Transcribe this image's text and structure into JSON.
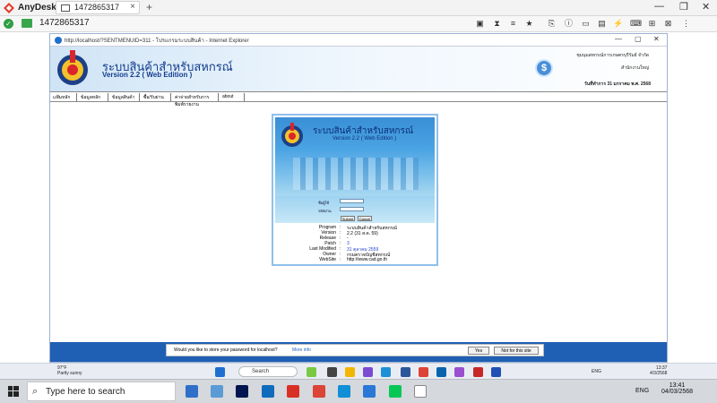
{
  "anydesk": {
    "app_name": "AnyDesk",
    "tab_label": "1472865317",
    "address": "1472865317"
  },
  "ie": {
    "title": "http://localhost/?SENTMENUID=311 - โปรแกรมระบบสินค้า - Internet Explorer"
  },
  "header": {
    "title": "ระบบสินค้าสำหรับสหกรณ์",
    "version": "Version 2.2 ( Web Edition )",
    "org": "ชุมนุมสหกรณ์การเกษตรบุรีรัมย์ จำกัด",
    "branch": "สำนักงานใหญ่",
    "date": "วันที่ทำการ 31 มกราคม พ.ศ. 2568"
  },
  "menu": {
    "items": [
      "แฟ้มหลัก",
      "ข้อมูลหลัก",
      "ข้อมูลสินค้า",
      "ซื้อ/รับผ่าน",
      "ค่าจ่ายสำหรับการพิมพ์รายงาน",
      "about"
    ]
  },
  "login": {
    "banner_title": "ระบบสินค้าสำหรับสหกรณ์",
    "banner_version": "Version 2.2 ( Web Edition )",
    "user_label": "ชื่อผู้ใช้",
    "pass_label": "รหัสผ่าน",
    "submit": "Submit",
    "cancel": "Cancel",
    "info": [
      {
        "k": "Program",
        "v": "ระบบสินค้าสำหรับสหกรณ์"
      },
      {
        "k": "Version",
        "v": "2.2 (31 ส.ค. 59)"
      },
      {
        "k": "Release",
        "v": "-"
      },
      {
        "k": "Patch",
        "v": "3"
      },
      {
        "k": "Last Modified",
        "v": "31 ตุลาคม 2559"
      },
      {
        "k": "Owner",
        "v": "กรมตรวจบัญชีสหกรณ์"
      },
      {
        "k": "WebSite",
        "v": "http://www.cad.go.th"
      }
    ]
  },
  "password_bar": {
    "question": "Would you like to store your password for localhost?",
    "more_info": "More info",
    "yes": "Yes",
    "not_for_site": "Not for this site"
  },
  "remote_taskbar": {
    "temp": "97°F",
    "weather": "Partly sunny",
    "search": "Search",
    "lang": "ENG",
    "time": "13:37",
    "date": "4/3/2568"
  },
  "local_taskbar": {
    "search": "Type here to search",
    "lang": "ENG",
    "time": "13:41",
    "date": "04/03/2568"
  },
  "colors": {
    "band": "#1f5fb4",
    "brand": "#123c8c"
  }
}
